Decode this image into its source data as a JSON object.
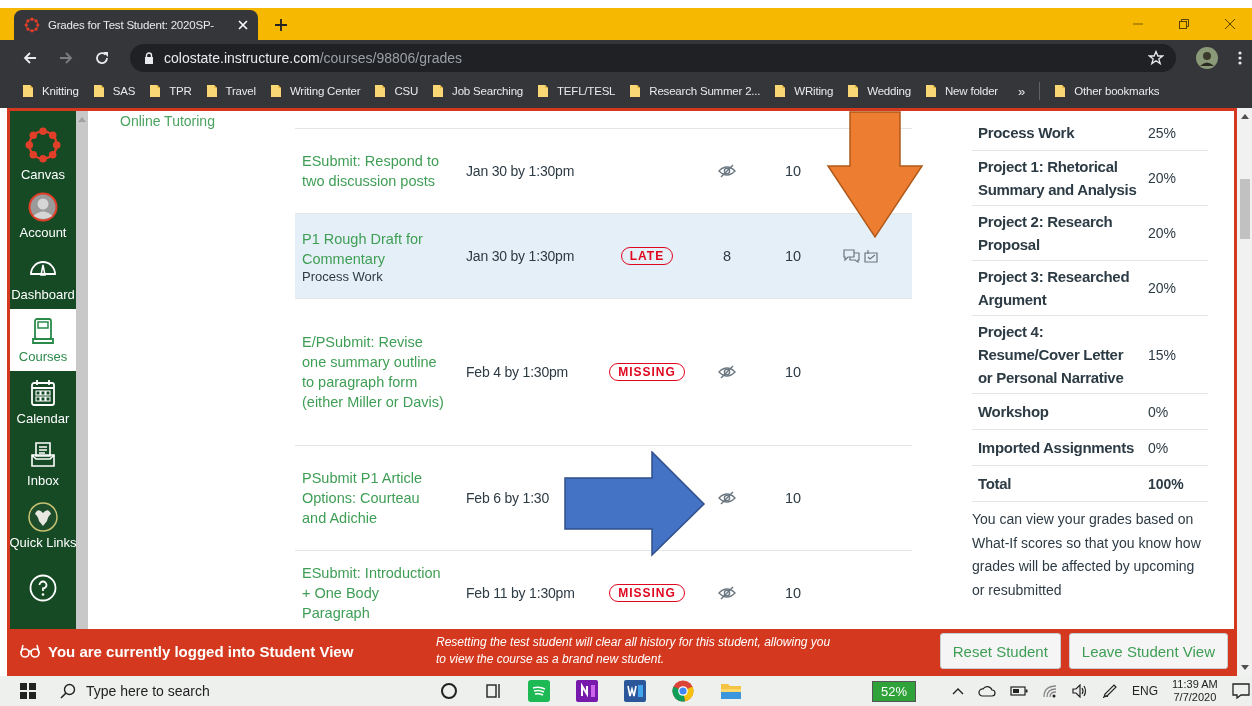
{
  "browser": {
    "tab_title": "Grades for Test Student: 2020SP-",
    "url_host": "colostate.instructure.com",
    "url_path": "/courses/98806/grades",
    "bookmarks": [
      "Knitting",
      "SAS",
      "TPR",
      "Travel",
      "Writing Center",
      "CSU",
      "Job Searching",
      "TEFL/TESL",
      "Research Summer 2...",
      "WRiting",
      "Wedding",
      "New folder"
    ],
    "overflow": "»",
    "other_bookmarks": "Other bookmarks"
  },
  "global_nav": [
    {
      "kind": "logo",
      "label": "Canvas",
      "selected": false
    },
    {
      "kind": "account",
      "label": "Account",
      "selected": false
    },
    {
      "kind": "dashboard",
      "label": "Dashboard",
      "selected": false
    },
    {
      "kind": "courses",
      "label": "Courses",
      "selected": true
    },
    {
      "kind": "calendar",
      "label": "Calendar",
      "selected": false
    },
    {
      "kind": "inbox",
      "label": "Inbox",
      "selected": false
    },
    {
      "kind": "ram",
      "label": "Quick Links",
      "selected": false
    },
    {
      "kind": "help",
      "selected": false
    }
  ],
  "course_nav": [
    "Online Tutoring"
  ],
  "assignments": [
    {
      "title": "ESubmit: Respond to two discussion posts",
      "due": "Jan 30 by 1:30pm",
      "score_hidden": true,
      "out_of": "10",
      "feedback": false,
      "selected": false
    },
    {
      "title": "P1 Rough Draft for Commentary",
      "group": "Process Work",
      "due": "Jan 30 by 1:30pm",
      "status": "LATE",
      "score_hidden": false,
      "score": "8",
      "out_of": "10",
      "feedback": true,
      "selected": true
    },
    {
      "title": "E/PSubmit: Revise one summary outline to paragraph form (either Miller or Davis)",
      "due": "Feb 4 by 1:30pm",
      "status": "MISSING",
      "score_hidden": true,
      "out_of": "10",
      "feedback": false,
      "selected": false
    },
    {
      "title": "PSubmit P1 Article Options: Courteau and Adichie",
      "due": "Feb 6 by 1:30",
      "score_hidden": true,
      "out_of": "10",
      "feedback": false,
      "selected": false
    },
    {
      "title": "ESubmit: Introduction + One Body Paragraph",
      "due": "Feb 11 by 1:30pm",
      "status": "MISSING",
      "score_hidden": true,
      "out_of": "10",
      "feedback": false,
      "selected": false
    }
  ],
  "weights": [
    {
      "group": "Process Work",
      "weight": "25%"
    },
    {
      "group": "Project 1: Rhetorical Summary and Analysis",
      "weight": "20%"
    },
    {
      "group": "Project 2: Research Proposal",
      "weight": "20%"
    },
    {
      "group": "Project 3: Researched Argument",
      "weight": "20%"
    },
    {
      "group": "Project 4: Resume/Cover Letter or Personal Narrative",
      "weight": "15%"
    },
    {
      "group": "Workshop",
      "weight": "0%"
    },
    {
      "group": "Imported Assignments",
      "weight": "0%"
    },
    {
      "group": "Total",
      "weight": "100%",
      "total": true
    }
  ],
  "what_if_note": "You can view your grades based on What-If scores so that you know how grades will be affected by upcoming or resubmitted",
  "student_view": {
    "message": "You are currently logged into Student View",
    "info": "Resetting the test student will clear all history for this student, allowing you to view the course as a brand new student.",
    "buttons": [
      "Reset Student",
      "Leave Student View"
    ]
  },
  "annotations": [
    {
      "kind": "arrow-down",
      "color": "#ed7d31"
    },
    {
      "kind": "arrow-right",
      "color": "#4472c4"
    }
  ],
  "taskbar": {
    "search_placeholder": "Type here to search",
    "battery": "52%",
    "language": "ENG",
    "time": "11:39 AM",
    "date": "7/7/2020"
  }
}
